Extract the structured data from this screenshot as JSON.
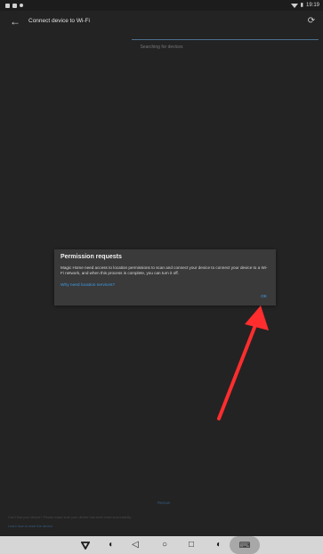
{
  "status_bar": {
    "time": "19:19"
  },
  "app_bar": {
    "title": "Connect device to Wi-Fi",
    "back_icon": "back-arrow-icon",
    "refresh_icon": "refresh-icon"
  },
  "scan": {
    "status": "Searching for devices"
  },
  "dialog": {
    "title": "Permission requests",
    "message": "Magic Home need access to location permissions to scan and connect your device to connect your device to a Wi-Fi network, and when this process is complete, you can turn it off.",
    "link": "Why need location services?",
    "ok": "OK"
  },
  "footer": {
    "rescan": "Rescan",
    "help_text": "Can't find your device? Please make sure your device has been reset successfully.",
    "help_link": "Learn how to reset the device"
  },
  "nav_bar": {
    "items": [
      "down-triangle-icon",
      "volume-icon",
      "back-icon",
      "home-icon",
      "recents-icon",
      "volume-up-icon",
      "keyboard-icon"
    ]
  },
  "colors": {
    "accent": "#3f9be6",
    "arrow": "#ff2d2d",
    "background": "#232323",
    "dialog": "#3a3a3a"
  }
}
